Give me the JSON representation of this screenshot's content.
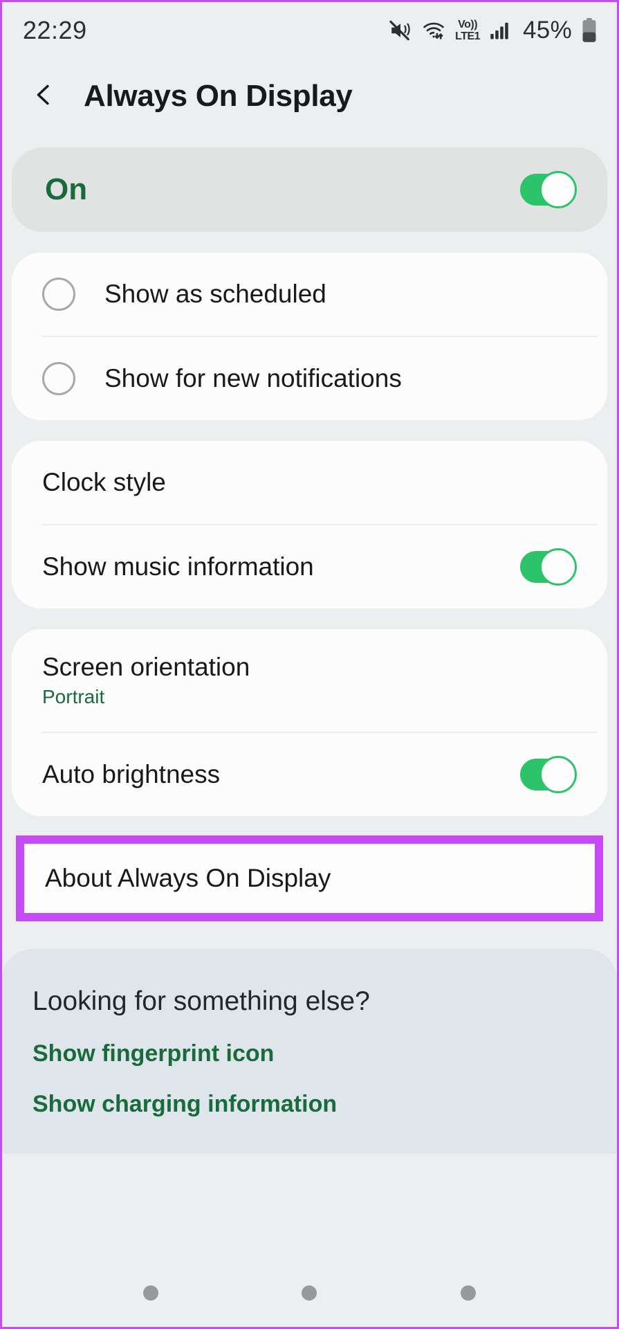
{
  "status_bar": {
    "time": "22:29",
    "icons": [
      "mute-icon",
      "wifi-icon",
      "volte-icon",
      "signal-icon"
    ],
    "volte_top": "Vo))",
    "volte_bottom": "LTE1",
    "battery_percent": "45%"
  },
  "header": {
    "back_icon": "chevron-left-icon",
    "title": "Always On Display"
  },
  "master": {
    "label": "On",
    "toggle_state": "on"
  },
  "schedule_options": [
    {
      "label": "Show as scheduled",
      "selected": false
    },
    {
      "label": "Show for new notifications",
      "selected": false
    }
  ],
  "clock_card": {
    "clock_style_label": "Clock style",
    "music_label": "Show music information",
    "music_toggle_state": "on"
  },
  "display_card": {
    "orientation_label": "Screen orientation",
    "orientation_value": "Portrait",
    "brightness_label": "Auto brightness",
    "brightness_toggle_state": "on"
  },
  "about_row": {
    "label": "About Always On Display",
    "highlighted": true
  },
  "looking": {
    "title": "Looking for something else?",
    "links": [
      "Show fingerprint icon",
      "Show charging information"
    ]
  },
  "navbar": {
    "dots": [
      "recents-dot",
      "home-dot",
      "back-dot"
    ]
  },
  "colors": {
    "accent_green": "#2dc36a",
    "text_green": "#1a6b3c",
    "highlight_purple": "#c44bf5",
    "page_background": "#eceff0",
    "card_background": "#fcfcfc",
    "looking_background": "#dee6ec"
  }
}
